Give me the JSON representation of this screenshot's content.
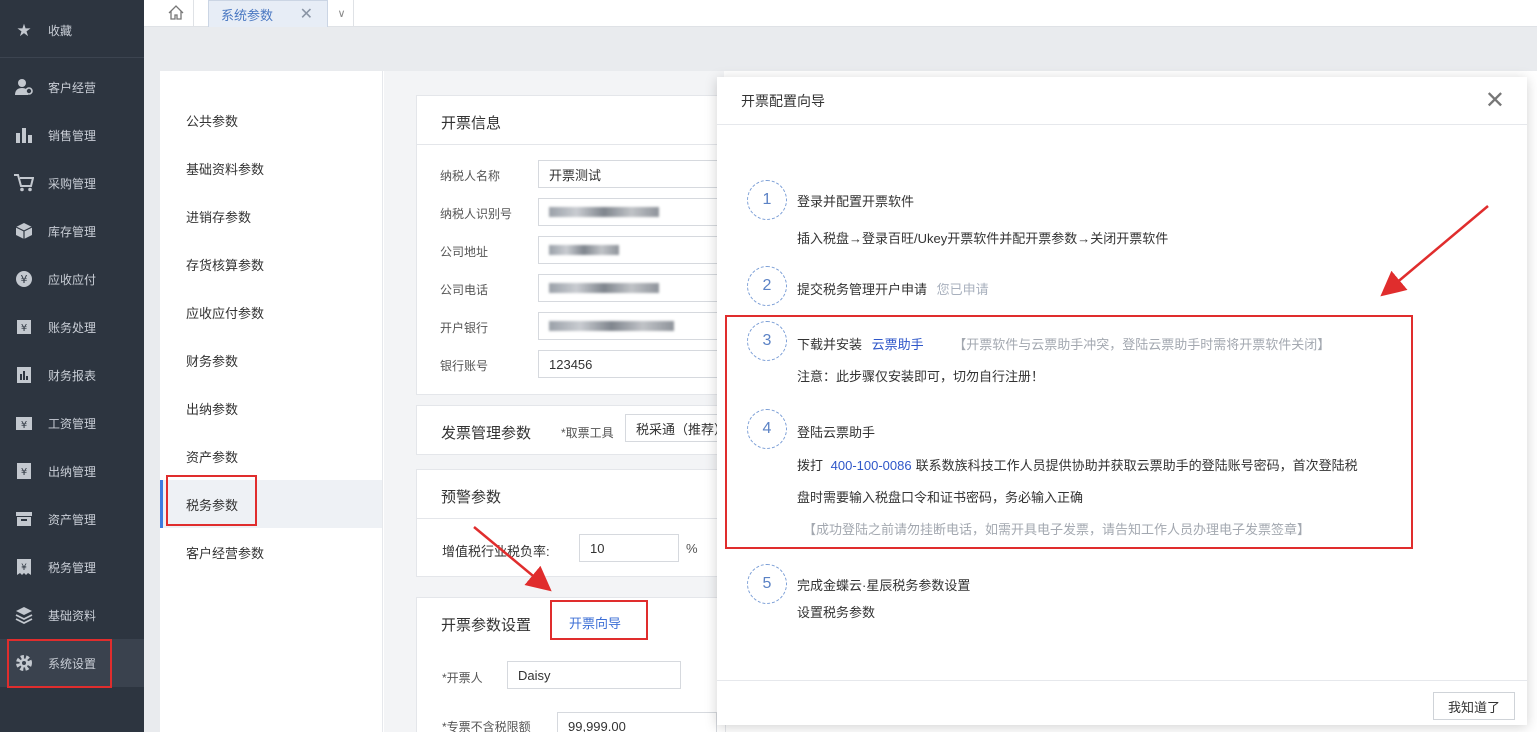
{
  "sidebar": {
    "items": [
      {
        "label": "收藏",
        "icon": "star-icon"
      },
      {
        "label": "客户经营",
        "icon": "user-gear-icon"
      },
      {
        "label": "销售管理",
        "icon": "bar-chart-icon"
      },
      {
        "label": "采购管理",
        "icon": "cart-icon"
      },
      {
        "label": "库存管理",
        "icon": "box-icon"
      },
      {
        "label": "应收应付",
        "icon": "coin-icon"
      },
      {
        "label": "账务处理",
        "icon": "ledger-icon"
      },
      {
        "label": "财务报表",
        "icon": "report-icon"
      },
      {
        "label": "工资管理",
        "icon": "salary-icon"
      },
      {
        "label": "出纳管理",
        "icon": "cashier-icon"
      },
      {
        "label": "资产管理",
        "icon": "asset-icon"
      },
      {
        "label": "税务管理",
        "icon": "tax-icon"
      },
      {
        "label": "基础资料",
        "icon": "layers-icon"
      },
      {
        "label": "系统设置",
        "icon": "gear-icon"
      }
    ]
  },
  "tabs": {
    "home_icon": "home-icon",
    "active_tab": "系统参数",
    "close_glyph": "✕",
    "more_glyph": "∨"
  },
  "settings_nav": {
    "items": [
      "公共参数",
      "基础资料参数",
      "进销存参数",
      "存货核算参数",
      "应收应付参数",
      "财务参数",
      "出纳参数",
      "资产参数",
      "税务参数",
      "客户经营参数"
    ],
    "active": "税务参数"
  },
  "invoice_info": {
    "title": "开票信息",
    "fields": [
      {
        "label": "纳税人名称",
        "value": "开票测试"
      },
      {
        "label": "纳税人识别号",
        "value": ""
      },
      {
        "label": "公司地址",
        "value": ""
      },
      {
        "label": "公司电话",
        "value": ""
      },
      {
        "label": "开户银行",
        "value": ""
      },
      {
        "label": "银行账号",
        "value": "123456"
      }
    ]
  },
  "invoice_mgmt": {
    "title": "发票管理参数",
    "tool_label": "*取票工具",
    "tool_value": "税采通（推荐）"
  },
  "warning": {
    "title": "预警参数",
    "rate_label": "增值税行业税负率:",
    "rate_value": "10",
    "unit": "%"
  },
  "invoice_settings": {
    "title": "开票参数设置",
    "wizard_link": "开票向导",
    "drawer_label": "*开票人",
    "drawer_value": "Daisy",
    "limit_label": "*专票不含税限额",
    "limit_value": "99,999.00"
  },
  "modal": {
    "title": "开票配置向导",
    "close_glyph": "✕",
    "ok_label": "我知道了",
    "steps": [
      {
        "num": "1",
        "title": "登录并配置开票软件",
        "desc": "插入税盘→登录百旺/Ukey开票软件并配开票参数→关闭开票软件"
      },
      {
        "num": "2",
        "title": "提交税务管理开户申请",
        "status": "您已申请"
      },
      {
        "num": "3",
        "title": "下载并安装",
        "link": "云票助手",
        "note": "【开票软件与云票助手冲突，登陆云票助手时需将开票软件关闭】",
        "desc": "注意：此步骤仅安装即可，切勿自行注册！"
      },
      {
        "num": "4",
        "title": "登陆云票助手",
        "desc_prefix": "拨打",
        "phone": "400-100-0086",
        "desc_rest": "联系数族科技工作人员提供协助并获取云票助手的登陆账号密码，首次登陆税",
        "desc_line2": "盘时需要输入税盘口令和证书密码，务必输入正确",
        "hint": "【成功登陆之前请勿挂断电话，如需开具电子发票，请告知工作人员办理电子发票签章】"
      },
      {
        "num": "5",
        "title": "完成金蝶云·星辰税务参数设置",
        "desc": "设置税务参数"
      }
    ]
  },
  "colors": {
    "sidebar_bg": "#2d3540",
    "accent": "#3d7be0",
    "link": "#2f57c9",
    "annotation_red": "#e02d2d"
  }
}
